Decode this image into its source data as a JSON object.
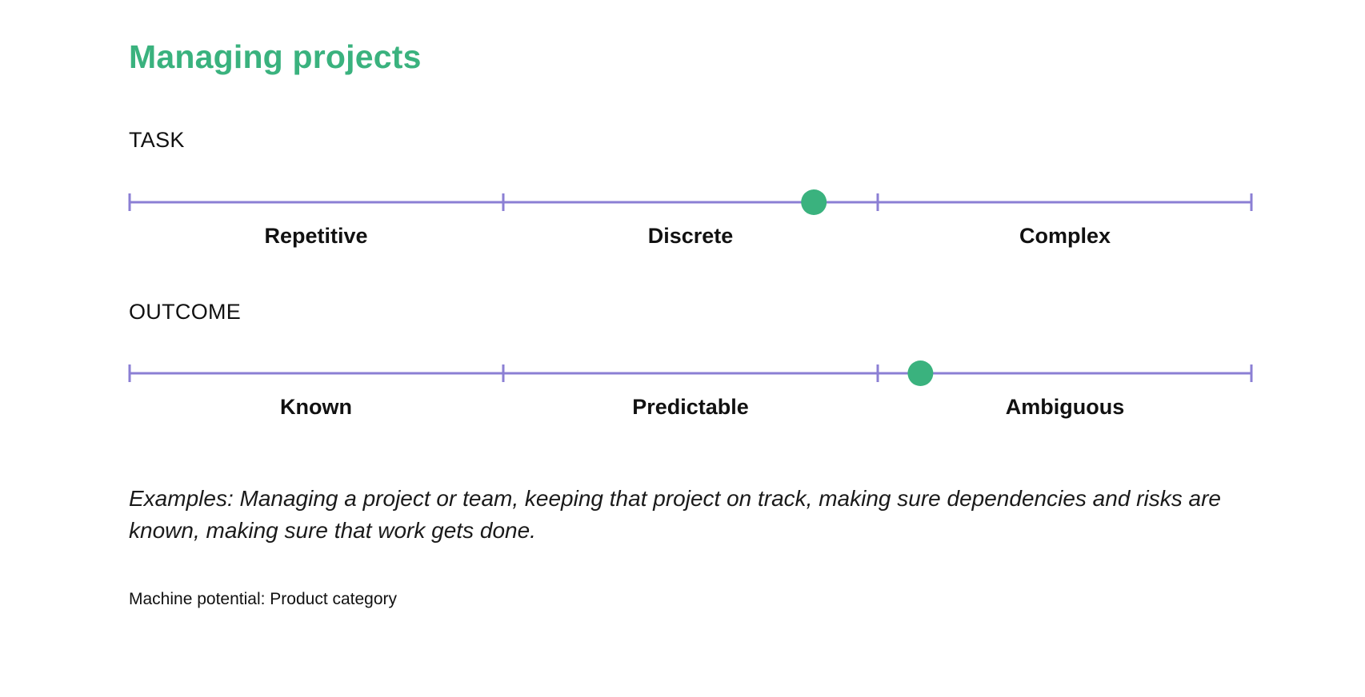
{
  "title": "Managing projects",
  "colors": {
    "title": "#3ab27e",
    "line": "#8b7fd4",
    "marker": "#3ab27e"
  },
  "scales": [
    {
      "heading": "TASK",
      "labels": [
        "Repetitive",
        "Discrete",
        "Complex"
      ],
      "marker_fraction": 0.61
    },
    {
      "heading": "OUTCOME",
      "labels": [
        "Known",
        "Predictable",
        "Ambiguous"
      ],
      "marker_fraction": 0.705
    }
  ],
  "examples": "Examples: Managing a project or team, keeping that project on track, making sure dependencies and risks are known, making sure that work gets done.",
  "footer": "Machine potential: Product category"
}
